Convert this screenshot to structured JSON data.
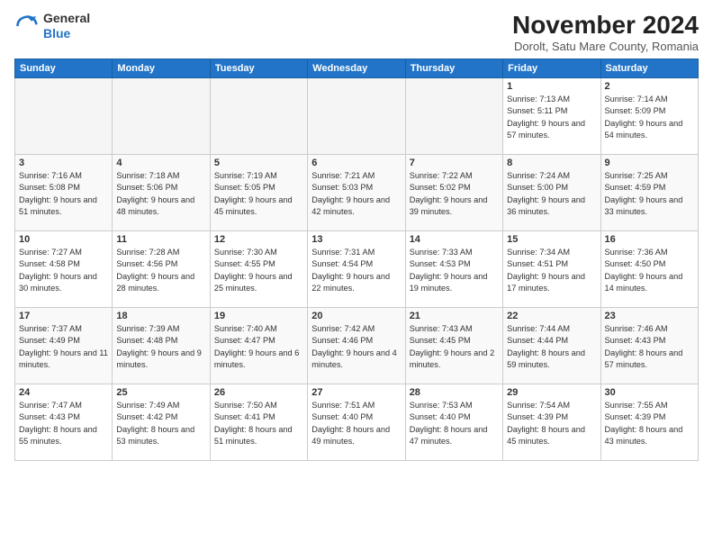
{
  "logo": {
    "general": "General",
    "blue": "Blue"
  },
  "header": {
    "title": "November 2024",
    "subtitle": "Dorolt, Satu Mare County, Romania"
  },
  "days_of_week": [
    "Sunday",
    "Monday",
    "Tuesday",
    "Wednesday",
    "Thursday",
    "Friday",
    "Saturday"
  ],
  "weeks": [
    [
      {
        "day": "",
        "info": ""
      },
      {
        "day": "",
        "info": ""
      },
      {
        "day": "",
        "info": ""
      },
      {
        "day": "",
        "info": ""
      },
      {
        "day": "",
        "info": ""
      },
      {
        "day": "1",
        "info": "Sunrise: 7:13 AM\nSunset: 5:11 PM\nDaylight: 9 hours and 57 minutes."
      },
      {
        "day": "2",
        "info": "Sunrise: 7:14 AM\nSunset: 5:09 PM\nDaylight: 9 hours and 54 minutes."
      }
    ],
    [
      {
        "day": "3",
        "info": "Sunrise: 7:16 AM\nSunset: 5:08 PM\nDaylight: 9 hours and 51 minutes."
      },
      {
        "day": "4",
        "info": "Sunrise: 7:18 AM\nSunset: 5:06 PM\nDaylight: 9 hours and 48 minutes."
      },
      {
        "day": "5",
        "info": "Sunrise: 7:19 AM\nSunset: 5:05 PM\nDaylight: 9 hours and 45 minutes."
      },
      {
        "day": "6",
        "info": "Sunrise: 7:21 AM\nSunset: 5:03 PM\nDaylight: 9 hours and 42 minutes."
      },
      {
        "day": "7",
        "info": "Sunrise: 7:22 AM\nSunset: 5:02 PM\nDaylight: 9 hours and 39 minutes."
      },
      {
        "day": "8",
        "info": "Sunrise: 7:24 AM\nSunset: 5:00 PM\nDaylight: 9 hours and 36 minutes."
      },
      {
        "day": "9",
        "info": "Sunrise: 7:25 AM\nSunset: 4:59 PM\nDaylight: 9 hours and 33 minutes."
      }
    ],
    [
      {
        "day": "10",
        "info": "Sunrise: 7:27 AM\nSunset: 4:58 PM\nDaylight: 9 hours and 30 minutes."
      },
      {
        "day": "11",
        "info": "Sunrise: 7:28 AM\nSunset: 4:56 PM\nDaylight: 9 hours and 28 minutes."
      },
      {
        "day": "12",
        "info": "Sunrise: 7:30 AM\nSunset: 4:55 PM\nDaylight: 9 hours and 25 minutes."
      },
      {
        "day": "13",
        "info": "Sunrise: 7:31 AM\nSunset: 4:54 PM\nDaylight: 9 hours and 22 minutes."
      },
      {
        "day": "14",
        "info": "Sunrise: 7:33 AM\nSunset: 4:53 PM\nDaylight: 9 hours and 19 minutes."
      },
      {
        "day": "15",
        "info": "Sunrise: 7:34 AM\nSunset: 4:51 PM\nDaylight: 9 hours and 17 minutes."
      },
      {
        "day": "16",
        "info": "Sunrise: 7:36 AM\nSunset: 4:50 PM\nDaylight: 9 hours and 14 minutes."
      }
    ],
    [
      {
        "day": "17",
        "info": "Sunrise: 7:37 AM\nSunset: 4:49 PM\nDaylight: 9 hours and 11 minutes."
      },
      {
        "day": "18",
        "info": "Sunrise: 7:39 AM\nSunset: 4:48 PM\nDaylight: 9 hours and 9 minutes."
      },
      {
        "day": "19",
        "info": "Sunrise: 7:40 AM\nSunset: 4:47 PM\nDaylight: 9 hours and 6 minutes."
      },
      {
        "day": "20",
        "info": "Sunrise: 7:42 AM\nSunset: 4:46 PM\nDaylight: 9 hours and 4 minutes."
      },
      {
        "day": "21",
        "info": "Sunrise: 7:43 AM\nSunset: 4:45 PM\nDaylight: 9 hours and 2 minutes."
      },
      {
        "day": "22",
        "info": "Sunrise: 7:44 AM\nSunset: 4:44 PM\nDaylight: 8 hours and 59 minutes."
      },
      {
        "day": "23",
        "info": "Sunrise: 7:46 AM\nSunset: 4:43 PM\nDaylight: 8 hours and 57 minutes."
      }
    ],
    [
      {
        "day": "24",
        "info": "Sunrise: 7:47 AM\nSunset: 4:43 PM\nDaylight: 8 hours and 55 minutes."
      },
      {
        "day": "25",
        "info": "Sunrise: 7:49 AM\nSunset: 4:42 PM\nDaylight: 8 hours and 53 minutes."
      },
      {
        "day": "26",
        "info": "Sunrise: 7:50 AM\nSunset: 4:41 PM\nDaylight: 8 hours and 51 minutes."
      },
      {
        "day": "27",
        "info": "Sunrise: 7:51 AM\nSunset: 4:40 PM\nDaylight: 8 hours and 49 minutes."
      },
      {
        "day": "28",
        "info": "Sunrise: 7:53 AM\nSunset: 4:40 PM\nDaylight: 8 hours and 47 minutes."
      },
      {
        "day": "29",
        "info": "Sunrise: 7:54 AM\nSunset: 4:39 PM\nDaylight: 8 hours and 45 minutes."
      },
      {
        "day": "30",
        "info": "Sunrise: 7:55 AM\nSunset: 4:39 PM\nDaylight: 8 hours and 43 minutes."
      }
    ]
  ]
}
